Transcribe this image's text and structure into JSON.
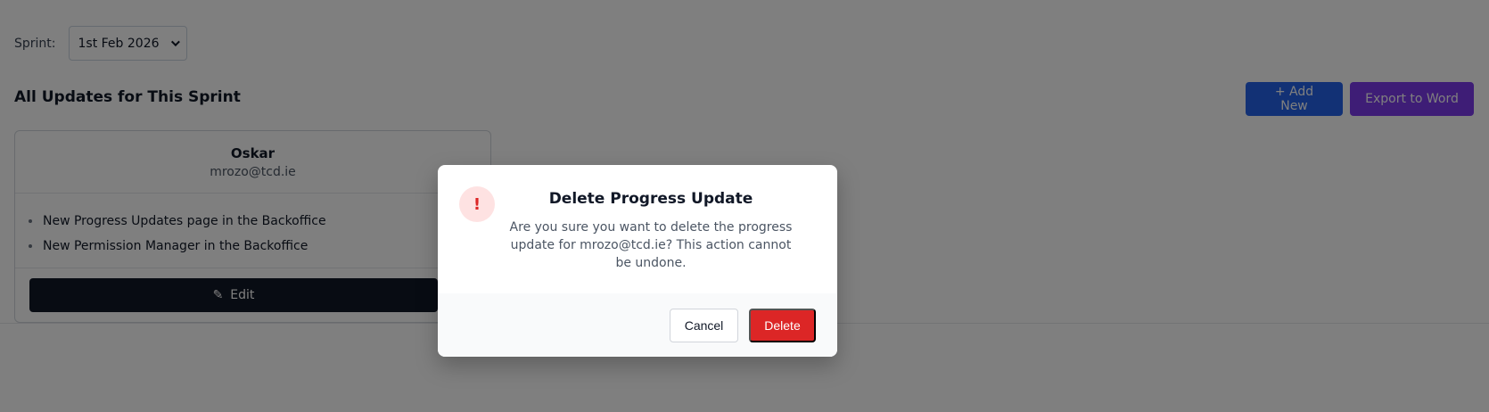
{
  "filters": {
    "sprint_label": "Sprint:",
    "sprint_selected": "1st Feb 2026"
  },
  "page": {
    "title": "All Updates for This Sprint",
    "add_label": "+ Add New",
    "export_label": "Export to Word"
  },
  "card": {
    "name": "Oskar",
    "email": "mrozo@tcd.ie",
    "updates": [
      "New Progress Updates page in the Backoffice",
      "New Permission Manager in the Backoffice"
    ],
    "edit_icon": "✎",
    "edit_label": "Edit"
  },
  "dialog": {
    "icon": "!",
    "title": "Delete Progress Update",
    "message": "Are you sure you want to delete the progress update for mrozo@tcd.ie? This action cannot be undone.",
    "cancel_label": "Cancel",
    "delete_label": "Delete"
  },
  "colors": {
    "primary": "#2563eb",
    "export": "#7c3aed",
    "danger": "#dc2626",
    "dark": "#111827"
  }
}
